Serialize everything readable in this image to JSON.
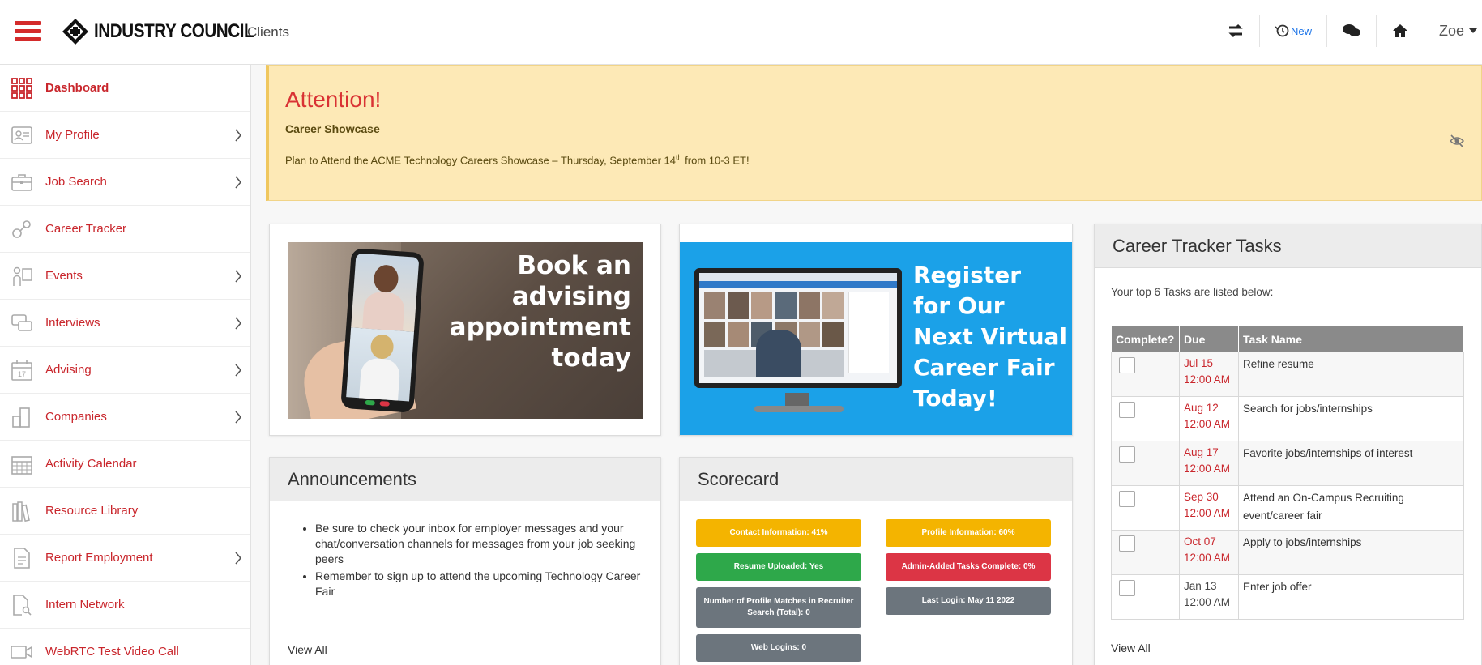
{
  "header": {
    "brand": "INDUSTRY COUNCIL",
    "clients_link": "Clients",
    "new_badge": "New",
    "user_name": "Zoe"
  },
  "sidebar": {
    "items": [
      {
        "label": "Dashboard",
        "icon": "dashboard-grid-icon",
        "active": true,
        "chevron": false
      },
      {
        "label": "My Profile",
        "icon": "profile-card-icon",
        "chevron": true
      },
      {
        "label": "Job Search",
        "icon": "briefcase-icon",
        "chevron": true
      },
      {
        "label": "Career Tracker",
        "icon": "career-tracker-icon",
        "chevron": false
      },
      {
        "label": "Events",
        "icon": "events-icon",
        "chevron": true
      },
      {
        "label": "Interviews",
        "icon": "chat-bubbles-icon",
        "chevron": true
      },
      {
        "label": "Advising",
        "icon": "calendar-17-icon",
        "chevron": true
      },
      {
        "label": "Companies",
        "icon": "buildings-icon",
        "chevron": true
      },
      {
        "label": "Activity Calendar",
        "icon": "calendar-grid-icon",
        "chevron": false
      },
      {
        "label": "Resource Library",
        "icon": "library-books-icon",
        "chevron": false
      },
      {
        "label": "Report Employment",
        "icon": "report-document-icon",
        "chevron": true
      },
      {
        "label": "Intern Network",
        "icon": "document-search-icon",
        "chevron": false
      },
      {
        "label": "WebRTC Test Video Call",
        "icon": "video-camera-icon",
        "chevron": false
      }
    ]
  },
  "attention": {
    "title": "Attention!",
    "subtitle": "Career Showcase",
    "text_before": "Plan to Attend the ACME Technology Careers Showcase – Thursday, September 14",
    "text_sup": "th",
    "text_after": " from 10-3 ET!"
  },
  "banners": {
    "advising": {
      "line1": "Book an",
      "line2": "advising",
      "line3": "appointment",
      "line4": "today"
    },
    "career_fair": {
      "line1": "Register",
      "line2": "for Our",
      "line3": "Next Virtual",
      "line4": "Career Fair",
      "line5": "Today!"
    }
  },
  "announcements": {
    "title": "Announcements",
    "items": [
      "Be sure to check your inbox for employer messages and your chat/conversation channels for messages from your job seeking peers",
      "Remember to sign up to attend the upcoming Technology Career Fair"
    ],
    "view_all": "View All"
  },
  "scorecard": {
    "title": "Scorecard",
    "items": [
      {
        "label": "Contact Information: 41%",
        "color": "#f4b400"
      },
      {
        "label": "Profile Information: 60%",
        "color": "#f4b400"
      },
      {
        "label": "Resume Uploaded: Yes",
        "color": "#2ea84a"
      },
      {
        "label": "Admin-Added Tasks Complete: 0%",
        "color": "#dc3545"
      },
      {
        "label": "Number of Profile Matches in Recruiter Search (Total): 0",
        "color": "#6c757d"
      },
      {
        "label": "Last Login: May 11 2022",
        "color": "#6c757d"
      },
      {
        "label": "Web Logins: 0",
        "color": "#6c757d"
      }
    ]
  },
  "tasks": {
    "title": "Career Tracker Tasks",
    "intro": "Your top 6 Tasks are listed below:",
    "columns": [
      "Complete?",
      "Due",
      "Task Name"
    ],
    "rows": [
      {
        "due_date": "Jul 15",
        "due_time": "12:00 AM",
        "name": "Refine resume",
        "overdue": true
      },
      {
        "due_date": "Aug 12",
        "due_time": "12:00 AM",
        "name": "Search for jobs/internships",
        "overdue": true
      },
      {
        "due_date": "Aug 17",
        "due_time": "12:00 AM",
        "name": "Favorite jobs/internships of interest",
        "overdue": true
      },
      {
        "due_date": "Sep 30",
        "due_time": "12:00 AM",
        "name": "Attend an On-Campus Recruiting event/career fair",
        "overdue": true
      },
      {
        "due_date": "Oct 07",
        "due_time": "12:00 AM",
        "name": "Apply to jobs/internships",
        "overdue": true
      },
      {
        "due_date": "Jan 13",
        "due_time": "12:00 AM",
        "name": "Enter job offer",
        "overdue": false
      }
    ],
    "view_all": "View All"
  }
}
